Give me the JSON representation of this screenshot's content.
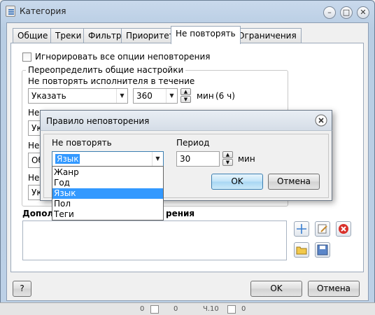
{
  "window": {
    "title": "Категория"
  },
  "tabs": [
    {
      "label": "Общие"
    },
    {
      "label": "Треки"
    },
    {
      "label": "Фильтр"
    },
    {
      "label": "Приоритет"
    },
    {
      "label": "Не повторять"
    },
    {
      "label": "Ограничения"
    }
  ],
  "active_tab": "Не повторять",
  "no_repeat": {
    "ignore_all_label": "Игнорировать все опции неповторения",
    "ignore_all_checked": false,
    "override_group_title": "Переопределить общие настройки",
    "artist_label": "Не повторять исполнителя в течение",
    "artist_mode": "Указать",
    "artist_value": "360",
    "artist_unit": "мин",
    "artist_hint": "(6 ч)",
    "hidden_label_fragment": "Не",
    "hidden_combo_fragments": [
      "Ук",
      "Об",
      "Ук"
    ],
    "additional_label_start": "Дополн",
    "additional_label_end": "рения"
  },
  "dialog_buttons": {
    "help": "?",
    "ok": "OK",
    "cancel": "Отмена"
  },
  "modal": {
    "title": "Правило неповторения",
    "field_label": "Не повторять",
    "field_value": "Язык",
    "period_label": "Период",
    "period_value": "30",
    "period_unit": "мин",
    "ok": "OK",
    "cancel": "Отмена",
    "dropdown_options": [
      "Жанр",
      "Год",
      "Язык",
      "Пол",
      "Теги"
    ],
    "dropdown_selected": "Язык"
  },
  "background_strip": [
    "0",
    "0",
    "Ч.10",
    "0"
  ],
  "colors": {
    "selection": "#3399ff",
    "default_button": "#bfe3f8",
    "title_gradient": "#c9d9ec"
  },
  "icons": [
    "add-icon",
    "edit-icon",
    "delete-icon",
    "open-folder-icon",
    "save-icon",
    "close-icon",
    "minimize-icon",
    "maximize-icon"
  ]
}
